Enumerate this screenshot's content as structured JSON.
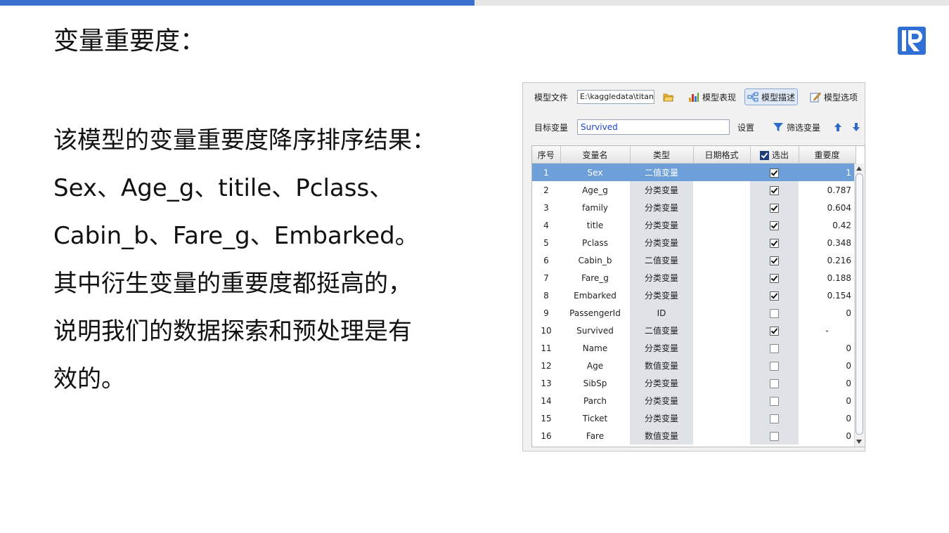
{
  "slide": {
    "title": "变量重要度：",
    "lines": [
      "该模型的变量重要度降序排序结果：",
      "Sex、Age_g、titile、Pclass、",
      "Cabin_b、Fare_g、Embarked。",
      "其中衍生变量的重要度都挺高的，",
      "说明我们的数据探索和预处理是有",
      "效的。"
    ]
  },
  "colors": {
    "accent": "#3a6fd0",
    "selected_row": "#6d9fd8",
    "target_text": "#1d44c8"
  },
  "toolbar": {
    "model_file_label": "模型文件",
    "model_file_value": "E:\\kaggledata\\titani",
    "model_performance_label": "模型表现",
    "model_description_label": "模型描述",
    "model_options_label": "模型选项",
    "target_label": "目标变量",
    "target_value": "Survived",
    "settings_label": "设置",
    "filter_label": "筛选变量"
  },
  "table": {
    "columns": [
      "序号",
      "变量名",
      "类型",
      "日期格式",
      "选出",
      "重要度"
    ],
    "rows": [
      {
        "no": "1",
        "name": "Sex",
        "type": "二值变量",
        "date": "",
        "selected": true,
        "importance": "1",
        "highlight": true
      },
      {
        "no": "2",
        "name": "Age_g",
        "type": "分类变量",
        "date": "",
        "selected": true,
        "importance": "0.787"
      },
      {
        "no": "3",
        "name": "family",
        "type": "分类变量",
        "date": "",
        "selected": true,
        "importance": "0.604"
      },
      {
        "no": "4",
        "name": "title",
        "type": "分类变量",
        "date": "",
        "selected": true,
        "importance": "0.42"
      },
      {
        "no": "5",
        "name": "Pclass",
        "type": "分类变量",
        "date": "",
        "selected": true,
        "importance": "0.348"
      },
      {
        "no": "6",
        "name": "Cabin_b",
        "type": "二值变量",
        "date": "",
        "selected": true,
        "importance": "0.216"
      },
      {
        "no": "7",
        "name": "Fare_g",
        "type": "分类变量",
        "date": "",
        "selected": true,
        "importance": "0.188"
      },
      {
        "no": "8",
        "name": "Embarked",
        "type": "分类变量",
        "date": "",
        "selected": true,
        "importance": "0.154"
      },
      {
        "no": "9",
        "name": "PassengerId",
        "type": "ID",
        "date": "",
        "selected": false,
        "importance": "0"
      },
      {
        "no": "10",
        "name": "Survived",
        "type": "二值变量",
        "date": "",
        "selected": true,
        "importance": "-",
        "center_imp": true
      },
      {
        "no": "11",
        "name": "Name",
        "type": "分类变量",
        "date": "",
        "selected": false,
        "importance": "0"
      },
      {
        "no": "12",
        "name": "Age",
        "type": "数值变量",
        "date": "",
        "selected": false,
        "importance": "0"
      },
      {
        "no": "13",
        "name": "SibSp",
        "type": "分类变量",
        "date": "",
        "selected": false,
        "importance": "0"
      },
      {
        "no": "14",
        "name": "Parch",
        "type": "分类变量",
        "date": "",
        "selected": false,
        "importance": "0"
      },
      {
        "no": "15",
        "name": "Ticket",
        "type": "分类变量",
        "date": "",
        "selected": false,
        "importance": "0"
      },
      {
        "no": "16",
        "name": "Fare",
        "type": "数值变量",
        "date": "",
        "selected": false,
        "importance": "0"
      }
    ]
  }
}
